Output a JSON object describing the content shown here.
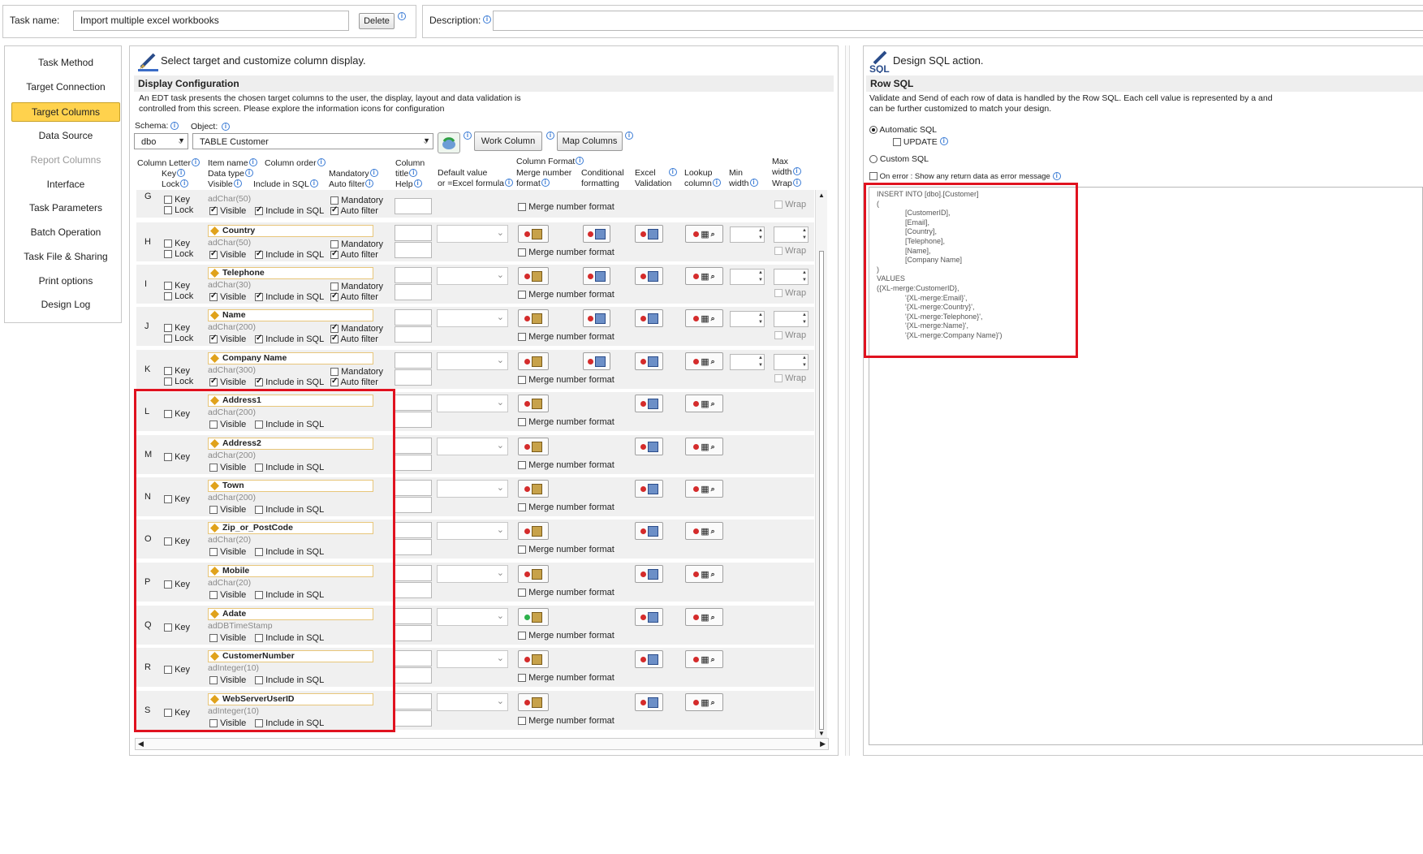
{
  "top": {
    "task_name_label": "Task name:",
    "task_name_value": "Import multiple excel workbooks",
    "delete_label": "Delete",
    "description_label": "Description:",
    "description_value": ""
  },
  "sidebar": {
    "items": [
      {
        "label": "Task Method"
      },
      {
        "label": "Target Connection"
      },
      {
        "label": "Target Columns"
      },
      {
        "label": "Data Source"
      },
      {
        "label": "Report Columns"
      },
      {
        "label": "Interface"
      },
      {
        "label": "Task Parameters"
      },
      {
        "label": "Batch Operation"
      },
      {
        "label": "Task File & Sharing"
      },
      {
        "label": "Print options"
      },
      {
        "label": "Design Log"
      }
    ],
    "selected": "Target Columns",
    "disabled": [
      "Report Columns"
    ]
  },
  "main": {
    "heading": "Select target and customize column display.",
    "section_title": "Display Configuration",
    "intro": "An EDT task presents the chosen target columns to the user, the display, layout and data validation is controlled from this screen.  Please explore the information icons for configuration",
    "schema_label": "Schema:",
    "schema_value": "dbo",
    "object_label": "Object:",
    "object_value": "TABLE Customer",
    "work_column_label": "Work Column",
    "map_columns_label": "Map Columns",
    "headers": {
      "column_letter": "Column Letter",
      "key": "Key",
      "lock": "Lock",
      "item_name": "Item name",
      "column_order": "Column order",
      "data_type": "Data type",
      "visible": "Visible",
      "include_in_sql": "Include in SQL",
      "mandatory": "Mandatory",
      "auto_filter": "Auto filter",
      "column_title": "Column",
      "title": "title",
      "help": "Help",
      "default_value": "Default value",
      "or_excel_formula": "or =Excel formula",
      "column_format": "Column Format",
      "merge_number_format": "Merge number",
      "format": "format",
      "conditional": "Conditional",
      "formatting": "formatting",
      "excel": "Excel",
      "validation": "Validation",
      "lookup": "Lookup",
      "column": "column",
      "min": "Min",
      "width": "width",
      "max": "Max",
      "max_width": "width",
      "wrap": "Wrap"
    },
    "row_labels": {
      "key": "Key",
      "lock": "Lock",
      "visible": "Visible",
      "include": "Include in SQL",
      "mandatory": "Mandatory",
      "auto_filter": "Auto filter",
      "merge": "Merge number format",
      "wrap": "Wrap"
    },
    "rows": [
      {
        "letter": "H",
        "name": "Country",
        "type": "adChar(50)",
        "full": true,
        "visible": true,
        "include": true,
        "mandatory": false,
        "autofilter": true,
        "green": false
      },
      {
        "letter": "I",
        "name": "Telephone",
        "type": "adChar(30)",
        "full": true,
        "visible": true,
        "include": true,
        "mandatory": false,
        "autofilter": true,
        "green": false
      },
      {
        "letter": "J",
        "name": "Name",
        "type": "adChar(200)",
        "full": true,
        "visible": true,
        "include": true,
        "mandatory": true,
        "autofilter": true,
        "green": false
      },
      {
        "letter": "K",
        "name": "Company Name",
        "type": "adChar(300)",
        "full": true,
        "visible": true,
        "include": true,
        "mandatory": false,
        "autofilter": true,
        "green": false
      },
      {
        "letter": "L",
        "name": "Address1",
        "type": "adChar(200)",
        "full": false,
        "visible": false,
        "include": false,
        "green": false
      },
      {
        "letter": "M",
        "name": "Address2",
        "type": "adChar(200)",
        "full": false,
        "visible": false,
        "include": false,
        "green": false
      },
      {
        "letter": "N",
        "name": "Town",
        "type": "adChar(200)",
        "full": false,
        "visible": false,
        "include": false,
        "green": false
      },
      {
        "letter": "O",
        "name": "Zip_or_PostCode",
        "type": "adChar(20)",
        "full": false,
        "visible": false,
        "include": false,
        "green": false
      },
      {
        "letter": "P",
        "name": "Mobile",
        "type": "adChar(20)",
        "full": false,
        "visible": false,
        "include": false,
        "green": false
      },
      {
        "letter": "Q",
        "name": "Adate",
        "type": "adDBTimeStamp",
        "full": false,
        "visible": false,
        "include": false,
        "green": true
      },
      {
        "letter": "R",
        "name": "CustomerNumber",
        "type": "adInteger(10)",
        "full": false,
        "visible": false,
        "include": false,
        "green": false
      },
      {
        "letter": "S",
        "name": "WebServerUserID",
        "type": "adInteger(10)",
        "full": false,
        "visible": false,
        "include": false,
        "green": false
      }
    ],
    "partial_row": {
      "letter": "G",
      "type": "adChar(50)"
    }
  },
  "sql_panel": {
    "heading": "Design SQL action.",
    "section_title": "Row SQL",
    "intro": "Validate and Send of each row of data is handled by the Row SQL.  Each cell value is represented by a and can be further customized to match your design.",
    "automatic_sql": "Automatic SQL",
    "update_label": "UPDATE",
    "custom_sql": "Custom SQL",
    "on_error": "On error : Show any return data as error message",
    "sql_text": "INSERT INTO [dbo].[Customer]\n(\n              [CustomerID],\n              [Email],\n              [Country],\n              [Telephone],\n              [Name],\n              [Company Name]\n)\nVALUES\n({XL-merge:CustomerID},\n              '{XL-merge:Email}',\n              '{XL-merge:Country}',\n              '{XL-merge:Telephone}',\n              '{XL-merge:Name}',\n              '{XL-merge:Company Name}')"
  }
}
